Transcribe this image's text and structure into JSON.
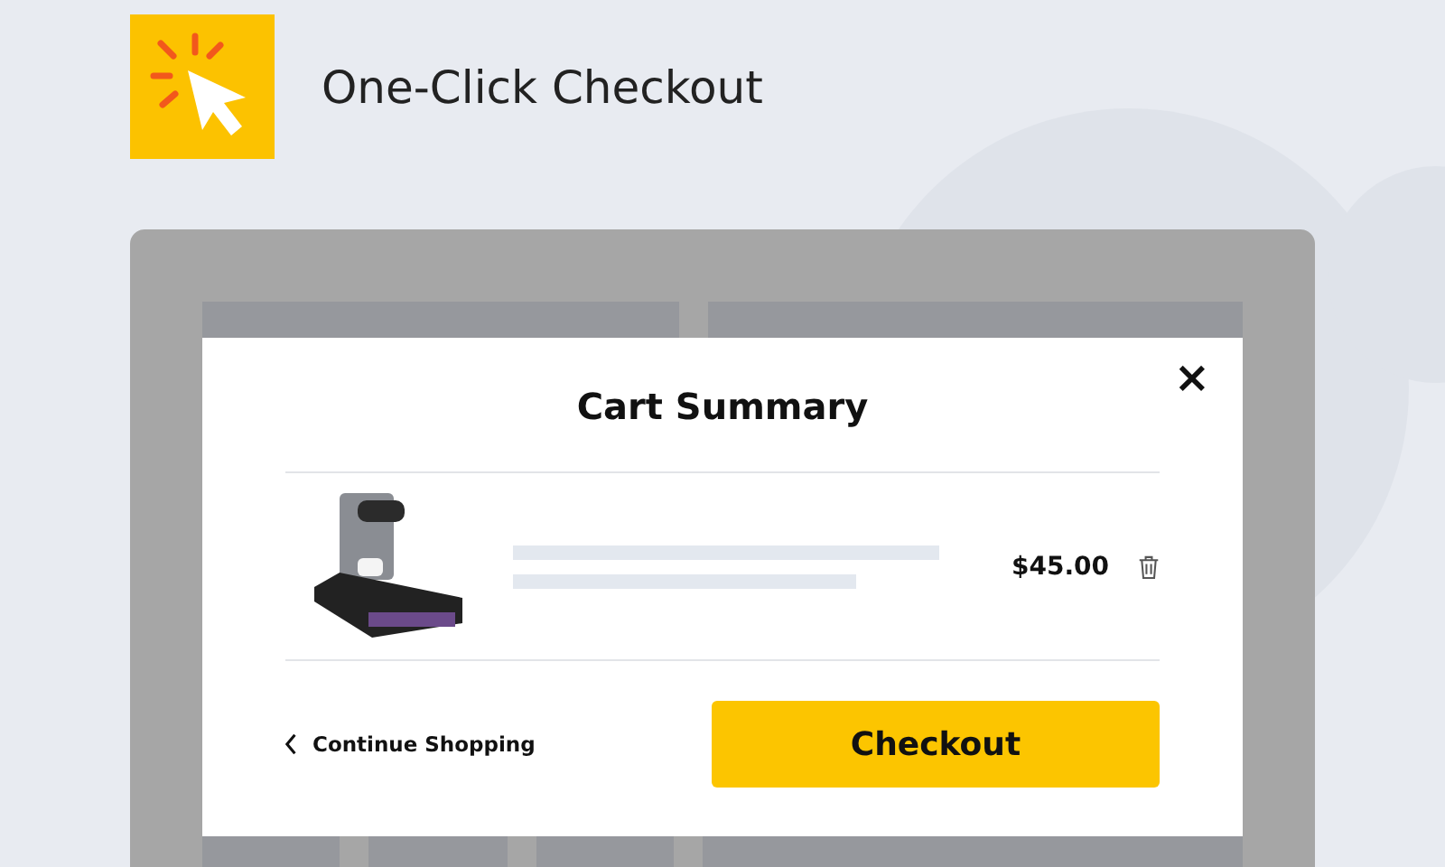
{
  "header": {
    "title": "One-Click Checkout"
  },
  "modal": {
    "title": "Cart Summary",
    "close": "×",
    "item": {
      "price": "$45.00"
    },
    "continue_link": "Continue Shopping",
    "checkout_button": "Checkout"
  }
}
